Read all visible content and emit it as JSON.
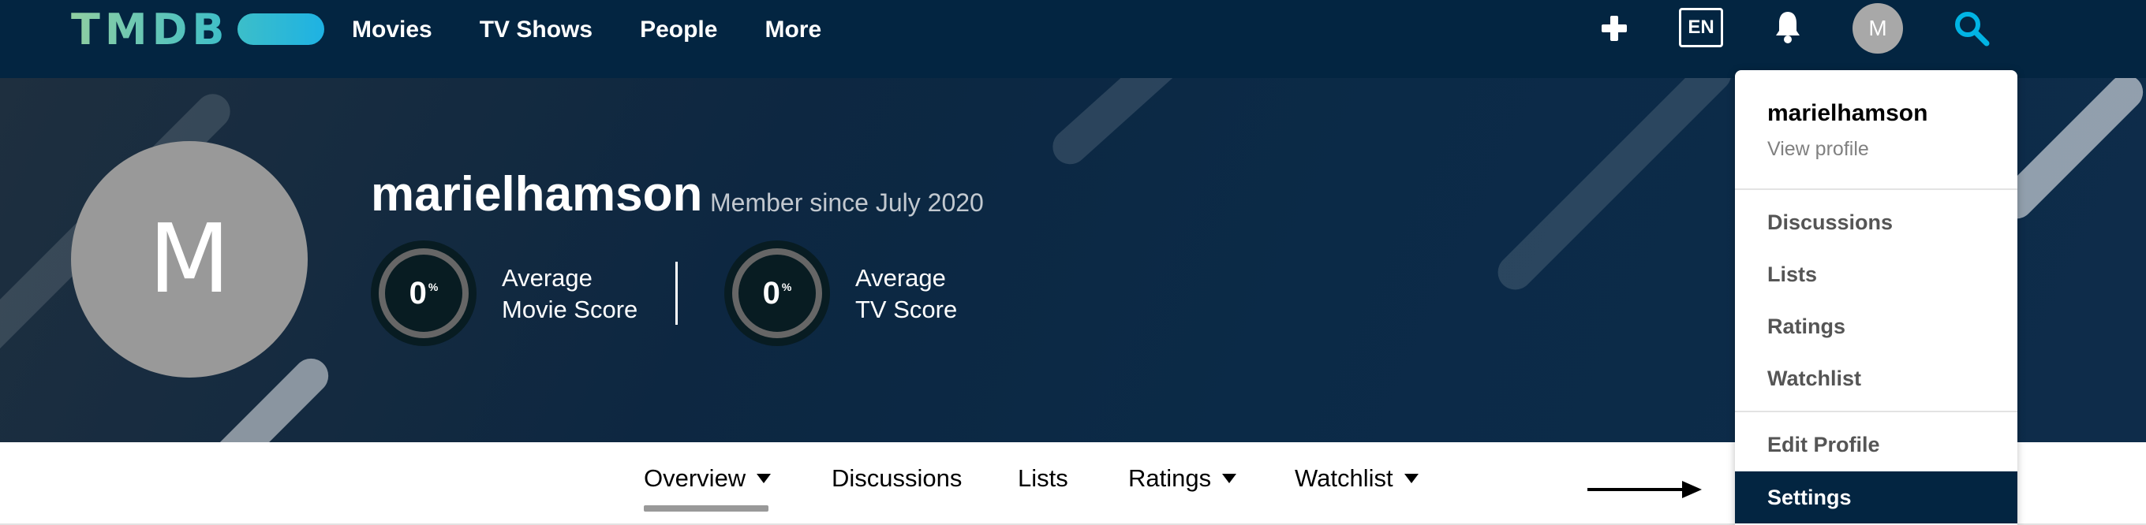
{
  "header": {
    "logo_text": "TMDB",
    "nav": [
      "Movies",
      "TV Shows",
      "People",
      "More"
    ],
    "language": "EN",
    "avatar_initial": "M",
    "icons": [
      "plus-icon",
      "bell-icon",
      "search-icon"
    ]
  },
  "profile": {
    "avatar_initial": "M",
    "username": "marielhamson",
    "member_since": "Member since July 2020",
    "scores": [
      {
        "value": "0",
        "unit": "%",
        "label_line1": "Average",
        "label_line2": "Movie Score",
        "percent": 0
      },
      {
        "value": "0",
        "unit": "%",
        "label_line1": "Average",
        "label_line2": "TV Score",
        "percent": 0
      }
    ]
  },
  "tabs": {
    "items": [
      "Overview",
      "Discussions",
      "Lists",
      "Ratings",
      "Watchlist"
    ],
    "active": "Overview"
  },
  "dropdown": {
    "username": "marielhamson",
    "view_profile": "View profile",
    "group1": [
      "Discussions",
      "Lists",
      "Ratings",
      "Watchlist"
    ],
    "group2": [
      "Edit Profile",
      "Settings"
    ],
    "highlighted": "Settings"
  },
  "colors": {
    "header_bg": "#032541",
    "accent_green": "#90cea1",
    "accent_blue": "#01b4e4",
    "avatar_gray": "#999999"
  }
}
